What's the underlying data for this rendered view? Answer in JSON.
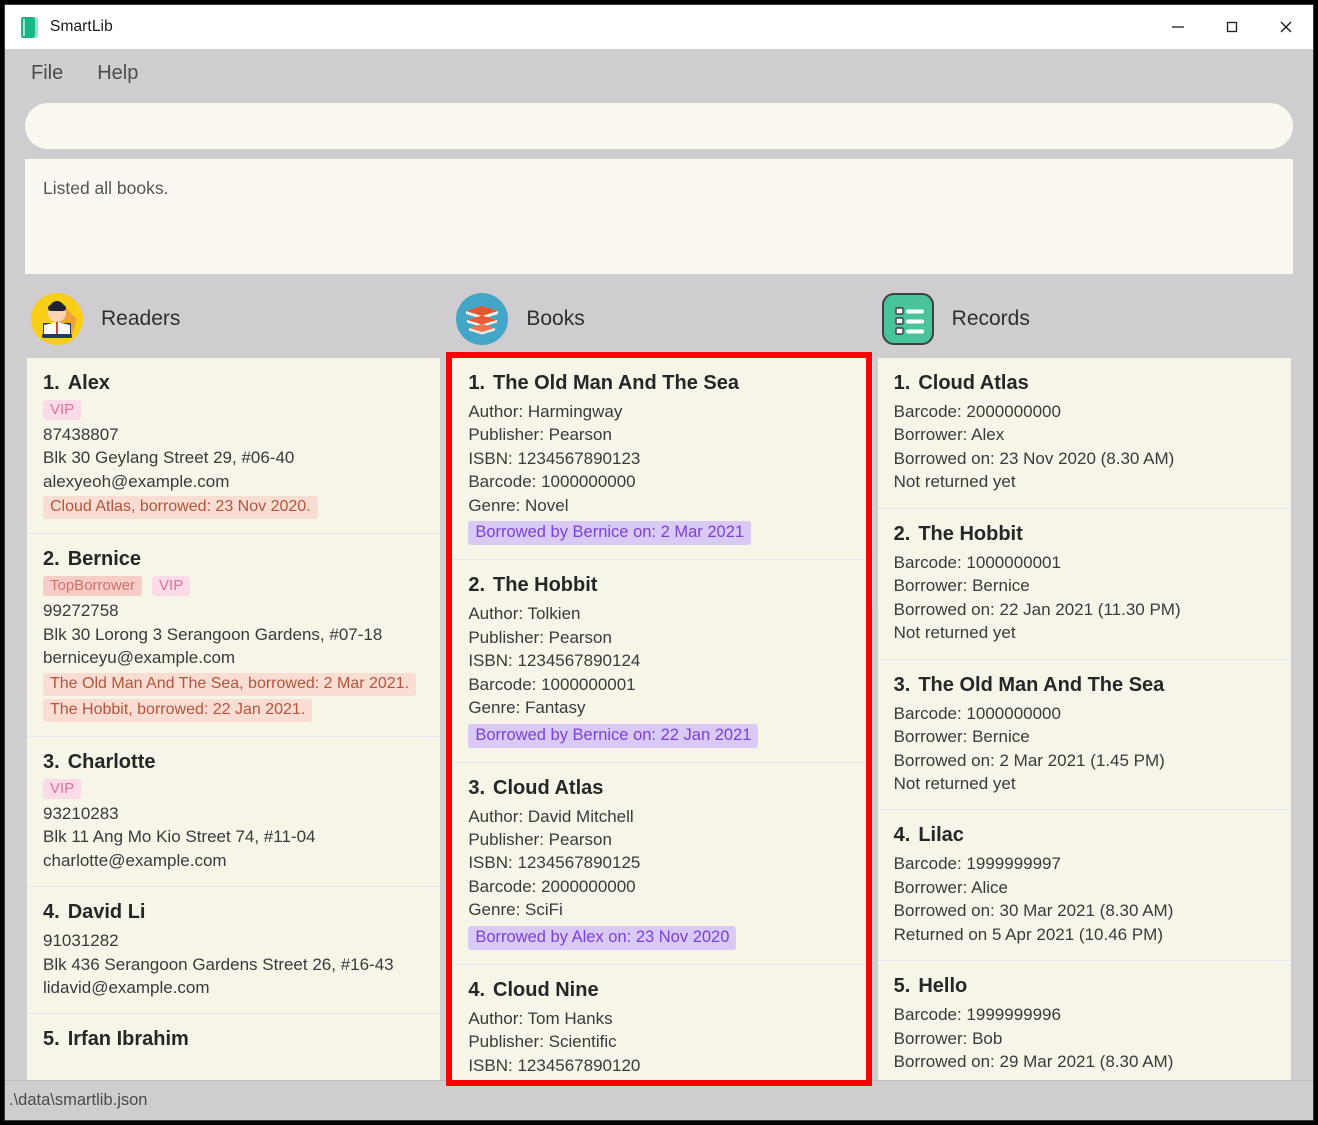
{
  "window": {
    "title": "SmartLib",
    "app_icon": "book-icon",
    "controls": {
      "minimize": "minimize-icon",
      "maximize": "maximize-icon",
      "close": "close-icon"
    }
  },
  "menubar": {
    "items": [
      {
        "label": "File"
      },
      {
        "label": "Help"
      }
    ]
  },
  "command_bar": {
    "value": "",
    "placeholder": ""
  },
  "result_panel": {
    "text": "Listed all books."
  },
  "colors": {
    "window_bg": "#cfcdd0",
    "list_bg": "#f7f5e8",
    "input_bg": "#faf8ee",
    "highlight_border": "#fe0000",
    "vip_badge_bg": "#fbdbe8",
    "vip_badge_text": "#e0709a",
    "top_badge_bg": "#f6ccc6",
    "top_badge_text": "#d3716a",
    "borrow_tag_bg": "#f9ddd3",
    "borrow_tag_text": "#b4543a",
    "borrowed_by_bg": "#d9c9f5",
    "borrowed_by_text": "#7a42d8",
    "readers_icon": "#f8ce16",
    "books_icon": "#44a6c6",
    "records_icon": "#49c49a"
  },
  "columns": {
    "readers": {
      "title": "Readers",
      "icon": "person-reading-icon",
      "highlighted": false,
      "scroll_thumb_pct": 35,
      "scroll_top_pct": 0,
      "items": [
        {
          "num": "1.",
          "name": "Alex",
          "tags": [
            {
              "label": "VIP",
              "type": "vip"
            }
          ],
          "phone": "87438807",
          "address": "Blk 30 Geylang Street 29, #06-40",
          "email": "alexyeoh@example.com",
          "borrows": [
            "Cloud Atlas, borrowed: 23 Nov 2020."
          ]
        },
        {
          "num": "2.",
          "name": "Bernice",
          "tags": [
            {
              "label": "TopBorrower",
              "type": "top"
            },
            {
              "label": "VIP",
              "type": "vip"
            }
          ],
          "phone": "99272758",
          "address": "Blk 30 Lorong 3 Serangoon Gardens, #07-18",
          "email": "berniceyu@example.com",
          "borrows": [
            "The Old Man And The Sea, borrowed: 2 Mar 2021.",
            "The Hobbit, borrowed: 22 Jan 2021."
          ]
        },
        {
          "num": "3.",
          "name": "Charlotte",
          "tags": [
            {
              "label": "VIP",
              "type": "vip"
            }
          ],
          "phone": "93210283",
          "address": "Blk 11 Ang Mo Kio Street 74, #11-04",
          "email": "charlotte@example.com",
          "borrows": []
        },
        {
          "num": "4.",
          "name": "David Li",
          "tags": [],
          "phone": "91031282",
          "address": "Blk 436 Serangoon Gardens Street 26, #16-43",
          "email": "lidavid@example.com",
          "borrows": []
        },
        {
          "num": "5.",
          "name": "Irfan Ibrahim",
          "tags": [],
          "phone": "",
          "address": "",
          "email": "",
          "borrows": [],
          "clipped": true
        }
      ]
    },
    "books": {
      "title": "Books",
      "icon": "stacked-books-icon",
      "highlighted": true,
      "scroll_thumb_pct": 35,
      "scroll_top_pct": 0,
      "items": [
        {
          "num": "1.",
          "name": "The Old Man And The Sea",
          "author": "Author: Harmingway",
          "publisher": "Publisher: Pearson",
          "isbn": "ISBN: 1234567890123",
          "barcode": "Barcode: 1000000000",
          "genre": "Genre: Novel",
          "borrowed_by": "Borrowed by Bernice on: 2 Mar 2021"
        },
        {
          "num": "2.",
          "name": "The Hobbit",
          "author": "Author: Tolkien",
          "publisher": "Publisher: Pearson",
          "isbn": "ISBN: 1234567890124",
          "barcode": "Barcode: 1000000001",
          "genre": "Genre: Fantasy",
          "borrowed_by": "Borrowed by Bernice on: 22 Jan 2021"
        },
        {
          "num": "3.",
          "name": "Cloud Atlas",
          "author": "Author: David Mitchell",
          "publisher": "Publisher: Pearson",
          "isbn": "ISBN: 1234567890125",
          "barcode": "Barcode: 2000000000",
          "genre": "Genre: SciFi",
          "borrowed_by": "Borrowed by Alex on: 23 Nov 2020"
        },
        {
          "num": "4.",
          "name": "Cloud Nine",
          "author": "Author: Tom Hanks",
          "publisher": "Publisher: Scientific",
          "isbn": "ISBN: 1234567890120",
          "barcode": "",
          "genre": "",
          "borrowed_by": "",
          "clipped": true
        }
      ]
    },
    "records": {
      "title": "Records",
      "icon": "list-records-icon",
      "highlighted": false,
      "scroll_thumb_pct": 80,
      "scroll_top_pct": 0,
      "items": [
        {
          "num": "1.",
          "name": "Cloud Atlas",
          "barcode": "Barcode: 2000000000",
          "borrower": "Borrower: Alex",
          "borrowed_on": "Borrowed on: 23 Nov 2020 (8.30 AM)",
          "status": "Not returned yet"
        },
        {
          "num": "2.",
          "name": "The Hobbit",
          "barcode": "Barcode: 1000000001",
          "borrower": "Borrower: Bernice",
          "borrowed_on": "Borrowed on: 22 Jan 2021 (11.30 PM)",
          "status": "Not returned yet"
        },
        {
          "num": "3.",
          "name": "The Old Man And The Sea",
          "barcode": "Barcode: 1000000000",
          "borrower": "Borrower: Bernice",
          "borrowed_on": "Borrowed on: 2 Mar 2021 (1.45 PM)",
          "status": "Not returned yet"
        },
        {
          "num": "4.",
          "name": "Lilac",
          "barcode": "Barcode: 1999999997",
          "borrower": "Borrower: Alice",
          "borrowed_on": "Borrowed on: 30 Mar 2021 (8.30 AM)",
          "status": "Returned on 5 Apr 2021 (10.46 PM)"
        },
        {
          "num": "5.",
          "name": "Hello",
          "barcode": "Barcode: 1999999996",
          "borrower": "Borrower: Bob",
          "borrowed_on": "Borrowed on: 29 Mar 2021 (8.30 AM)",
          "status": "",
          "clipped": true
        }
      ]
    }
  },
  "statusbar": {
    "path": ".\\data\\smartlib.json"
  }
}
